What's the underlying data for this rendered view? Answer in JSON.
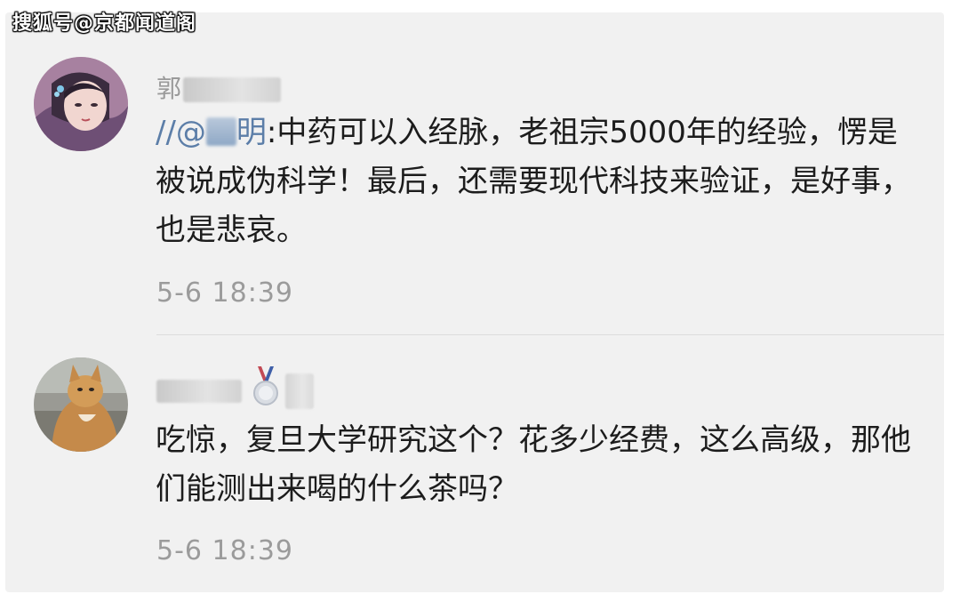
{
  "watermark": "搜狐号@京都闻道阁",
  "comments": [
    {
      "username_visible": "郭",
      "avatar_icon": "anime-girl-avatar-icon",
      "mention_prefix": "//@",
      "mention_name_visible": "明",
      "text_after_mention": ":中药可以入经脉，老祖宗5000年的经验，愣是被说成伪科学！最后，还需要现代科技来验证，是好事，也是悲哀。",
      "timestamp": "5-6 18:39"
    },
    {
      "username_visible": "",
      "avatar_icon": "cat-avatar-icon",
      "badge_icon": "medal-badge-icon",
      "text": "吃惊，复旦大学研究这个？花多少经费，这么高级，那他们能测出来喝的什么茶吗？",
      "timestamp": "5-6 18:39"
    }
  ]
}
